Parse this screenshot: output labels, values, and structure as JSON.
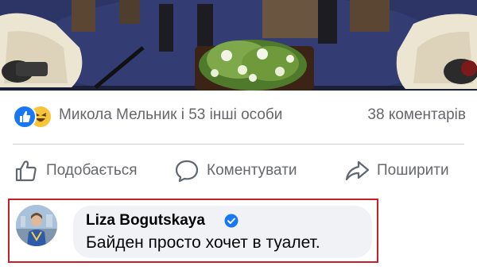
{
  "post": {
    "photo_alt": "",
    "reactions": {
      "icons": [
        "like-icon",
        "haha-icon"
      ],
      "summary": "Микола Мельник і 53 інші особи",
      "comments": "38 коментарів"
    },
    "actions": {
      "like_label": "Подобається",
      "comment_label": "Коментувати",
      "share_label": "Поширити"
    }
  },
  "comment": {
    "author": "Liza Bogutskaya",
    "verified": true,
    "text": "Байден просто хочет в туалет.",
    "highlight_color": "#c8202a"
  },
  "colors": {
    "like_blue": "#1877f2",
    "haha_yellow": "#f7c43a",
    "secondary_text": "#65676b",
    "bubble_bg": "#f0f2f5"
  }
}
